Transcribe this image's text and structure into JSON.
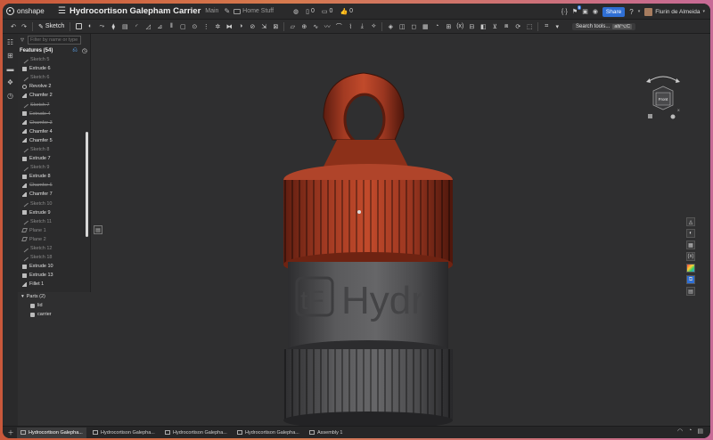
{
  "app": {
    "name": "onshape"
  },
  "document": {
    "title": "Hydrocortison Galepham Carrier",
    "branch": "Main",
    "folder": "Home Stuff"
  },
  "header_counts": {
    "versions": "0",
    "comments": "0",
    "likes": "0"
  },
  "header_right": {
    "share_label": "Share",
    "user_name": "Flurin de Almeida",
    "notification_count": "9"
  },
  "toolbar": {
    "sketch_label": "Sketch",
    "search_tools_label": "Search tools...",
    "search_tools_shortcut": "alt/⌥C"
  },
  "feature_panel": {
    "filter_placeholder": "Filter by name or type",
    "title": "Features (54)",
    "features": [
      {
        "label": "Sketch 5",
        "type": "sketch",
        "state": "muted"
      },
      {
        "label": "Extrude 6",
        "type": "extrude",
        "state": "normal"
      },
      {
        "label": "Sketch 6",
        "type": "sketch",
        "state": "muted"
      },
      {
        "label": "Revolve 2",
        "type": "revolve",
        "state": "normal"
      },
      {
        "label": "Chamfer 2",
        "type": "chamfer",
        "state": "normal"
      },
      {
        "label": "Sketch 7",
        "type": "sketch",
        "state": "struck"
      },
      {
        "label": "Extrude 4",
        "type": "extrude",
        "state": "struck"
      },
      {
        "label": "Chamfer 3",
        "type": "chamfer",
        "state": "struck"
      },
      {
        "label": "Chamfer 4",
        "type": "chamfer",
        "state": "normal"
      },
      {
        "label": "Chamfer 5",
        "type": "chamfer",
        "state": "normal"
      },
      {
        "label": "Sketch 8",
        "type": "sketch",
        "state": "muted"
      },
      {
        "label": "Extrude 7",
        "type": "extrude",
        "state": "normal"
      },
      {
        "label": "Sketch 9",
        "type": "sketch",
        "state": "muted"
      },
      {
        "label": "Extrude 8",
        "type": "extrude",
        "state": "normal"
      },
      {
        "label": "Chamfer 6",
        "type": "chamfer",
        "state": "struck"
      },
      {
        "label": "Chamfer 7",
        "type": "chamfer",
        "state": "normal"
      },
      {
        "label": "Sketch 10",
        "type": "sketch",
        "state": "muted"
      },
      {
        "label": "Extrude 9",
        "type": "extrude",
        "state": "normal"
      },
      {
        "label": "Sketch 11",
        "type": "sketch",
        "state": "muted"
      },
      {
        "label": "Plane 1",
        "type": "plane",
        "state": "muted"
      },
      {
        "label": "Plane 2",
        "type": "plane",
        "state": "muted"
      },
      {
        "label": "Sketch 12",
        "type": "sketch",
        "state": "muted"
      },
      {
        "label": "Sketch 18",
        "type": "sketch",
        "state": "muted"
      },
      {
        "label": "Extrude 10",
        "type": "extrude",
        "state": "normal"
      },
      {
        "label": "Extrude 13",
        "type": "extrude",
        "state": "normal"
      },
      {
        "label": "Fillet 1",
        "type": "chamfer",
        "state": "normal"
      }
    ],
    "parts_title": "Parts (2)",
    "parts": [
      {
        "label": "lid"
      },
      {
        "label": "carrier"
      }
    ]
  },
  "viewcube": {
    "face_label": "Front",
    "axis_x": "X"
  },
  "model_text": {
    "emboss_badge": "tF",
    "emboss_word": "Hydr"
  },
  "colors": {
    "lid": "#a83a22",
    "body": "#555557",
    "background": "#2f2f30",
    "accent": "#2f6fd4"
  },
  "tabs": [
    {
      "label": "Hydrocortison Galepha...",
      "icon": "part-studio-icon",
      "active": true
    },
    {
      "label": "Hydrocortison Galepha...",
      "icon": "part-studio-icon",
      "active": false
    },
    {
      "label": "Hydrocortison Galepha...",
      "icon": "part-studio-icon",
      "active": false
    },
    {
      "label": "Hydrocortison Galepha...",
      "icon": "part-studio-icon",
      "active": false
    },
    {
      "label": "Assembly 1",
      "icon": "assembly-icon",
      "active": false
    }
  ]
}
